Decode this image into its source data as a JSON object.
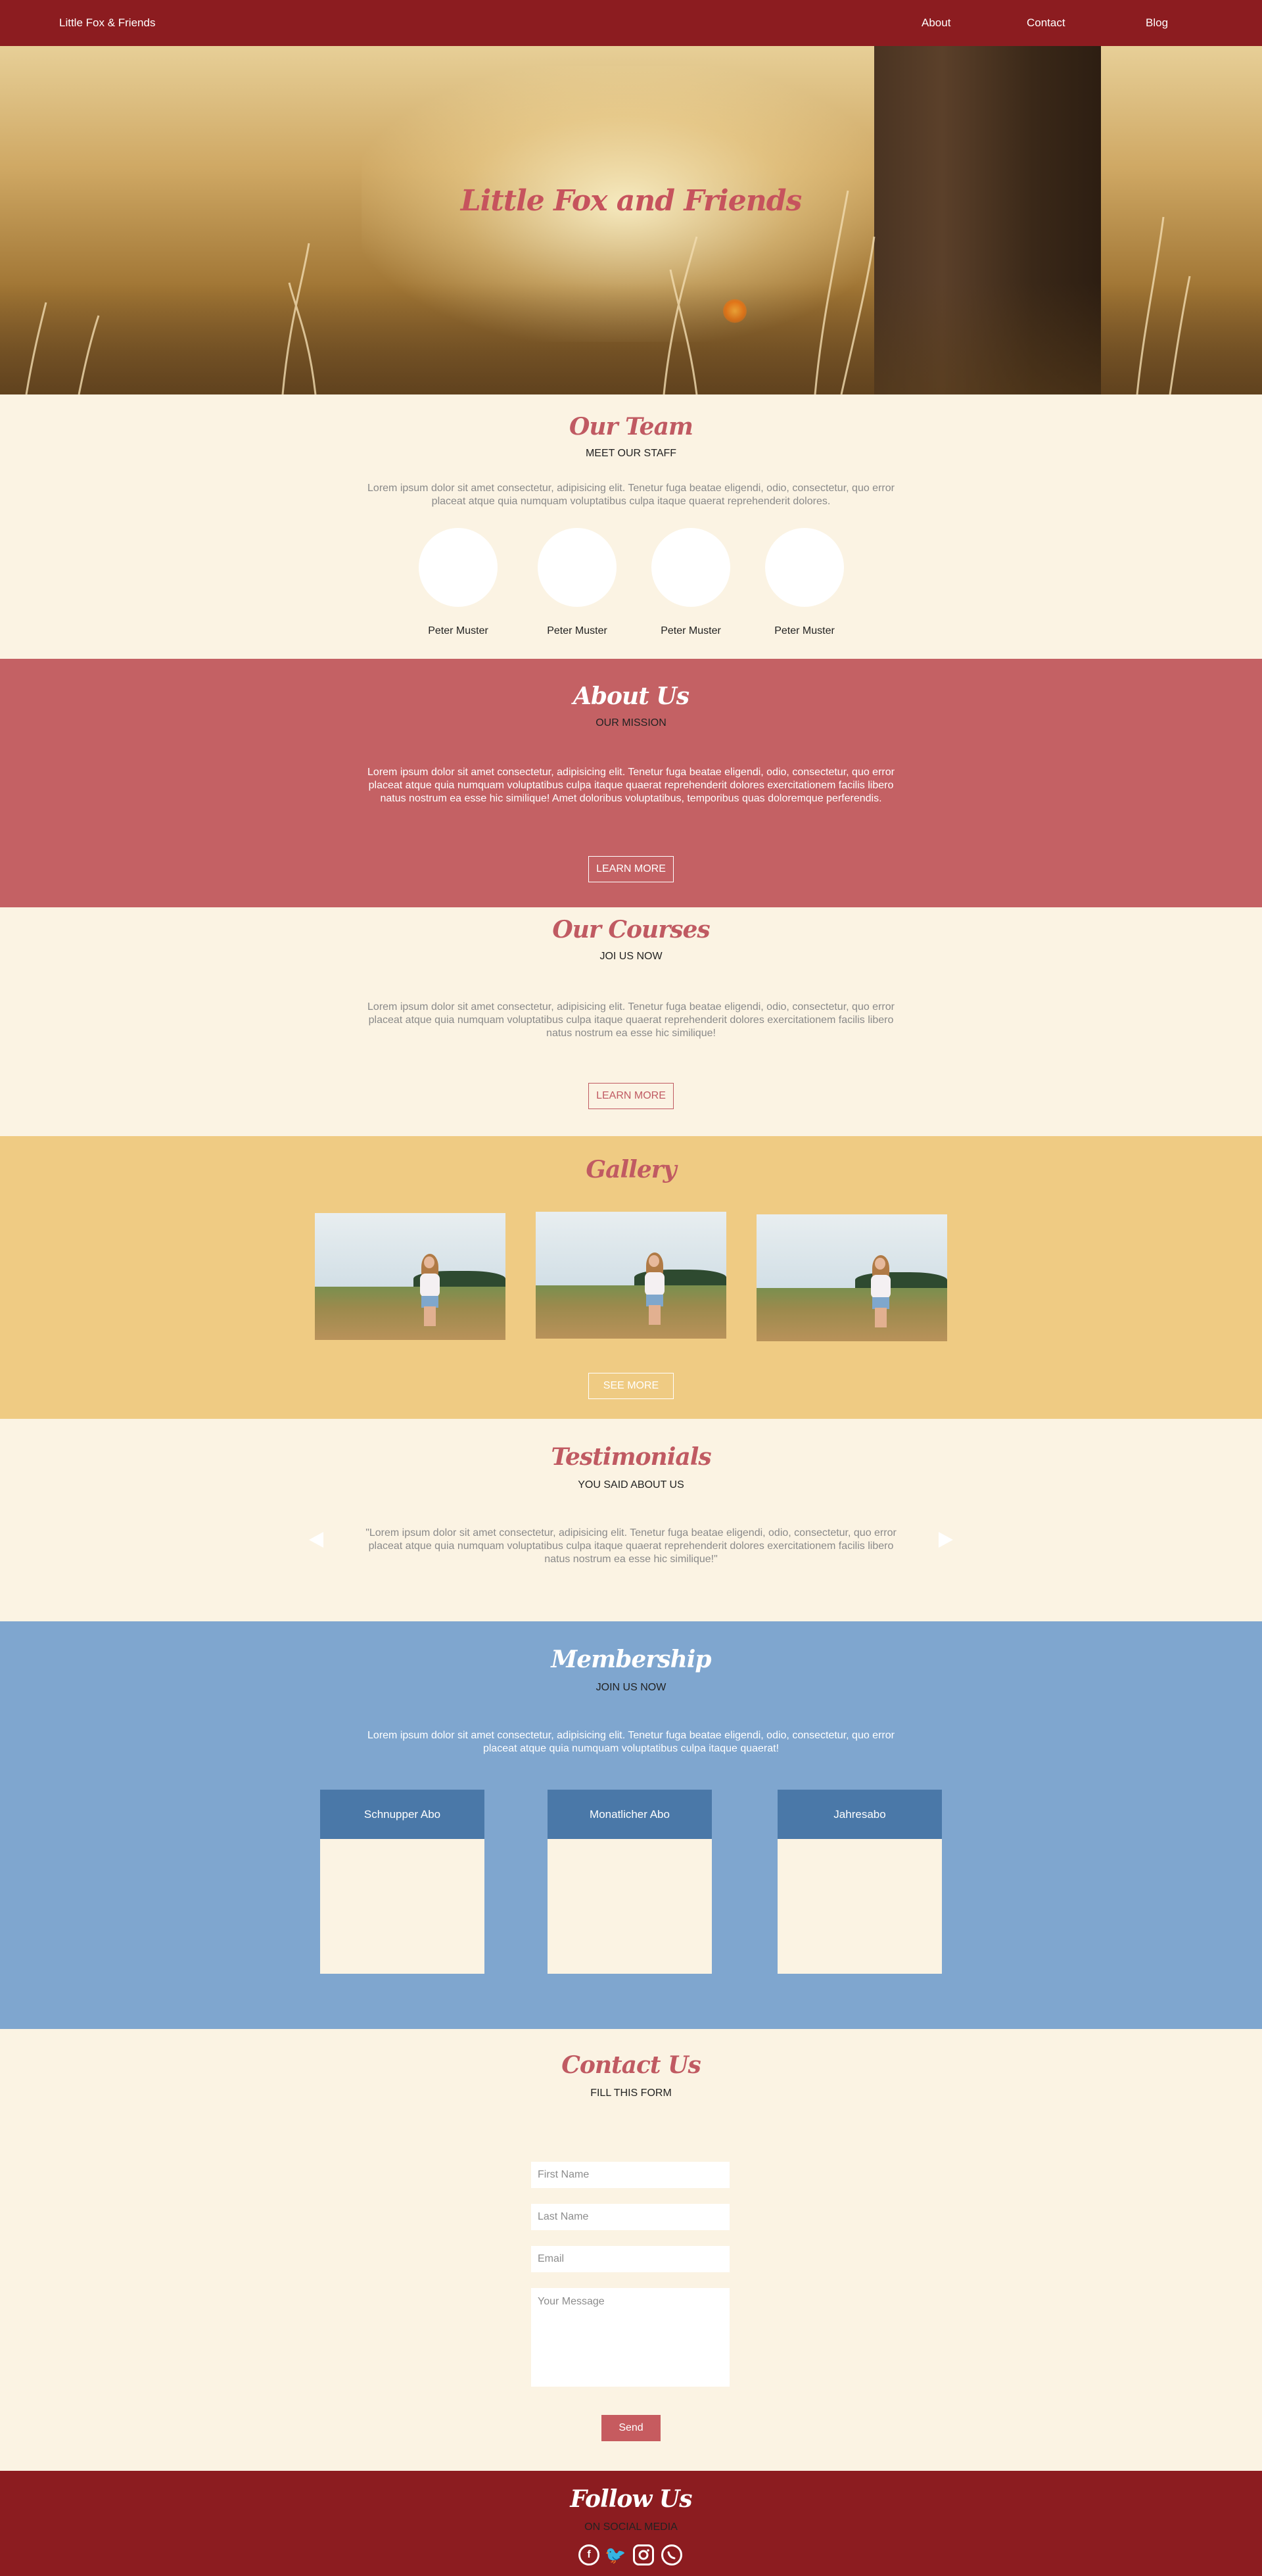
{
  "navbar": {
    "brand": "Little Fox & Friends",
    "links": [
      "About",
      "Contact",
      "Blog"
    ]
  },
  "hero": {
    "title": "Little Fox and Friends"
  },
  "team": {
    "title": "Our Team",
    "subtitle": "MEET OUR STAFF",
    "text": "Lorem ipsum dolor sit amet consectetur, adipisicing elit. Tenetur fuga beatae eligendi, odio, consectetur, quo error placeat atque quia numquam voluptatibus culpa itaque quaerat reprehenderit dolores.",
    "members": [
      "Peter Muster",
      "Peter Muster",
      "Peter Muster",
      "Peter Muster"
    ]
  },
  "about": {
    "title": "About Us",
    "subtitle": "OUR MISSION",
    "text": "Lorem ipsum dolor sit amet consectetur, adipisicing elit. Tenetur fuga beatae eligendi, odio, consectetur, quo error placeat atque quia numquam voluptatibus culpa itaque quaerat reprehenderit dolores exercitationem facilis libero natus nostrum ea esse hic similique! Amet doloribus voluptatibus, temporibus quas doloremque perferendis.",
    "button": "LEARN MORE"
  },
  "courses": {
    "title": "Our Courses",
    "subtitle": "JOI US NOW",
    "text": "Lorem ipsum dolor sit amet consectetur, adipisicing elit. Tenetur fuga beatae eligendi, odio, consectetur, quo error placeat atque quia numquam voluptatibus culpa itaque quaerat reprehenderit dolores exercitationem facilis libero natus nostrum ea esse hic similique!",
    "button": "LEARN MORE"
  },
  "gallery": {
    "title": "Gallery",
    "button": "SEE MORE"
  },
  "testimonials": {
    "title": "Testimonials",
    "subtitle": "YOU SAID ABOUT US",
    "quote": "\"Lorem ipsum dolor sit amet consectetur, adipisicing elit. Tenetur fuga beatae eligendi, odio, consectetur, quo error placeat atque quia numquam voluptatibus culpa itaque quaerat reprehenderit dolores exercitationem facilis libero natus nostrum ea esse hic similique!\""
  },
  "membership": {
    "title": "Membership",
    "subtitle": "JOIN US NOW",
    "text": "Lorem ipsum dolor sit amet consectetur, adipisicing elit. Tenetur fuga beatae eligendi, odio, consectetur, quo error placeat atque quia numquam voluptatibus culpa itaque quaerat!",
    "plans": [
      "Schnupper Abo",
      "Monatlicher Abo",
      "Jahresabo"
    ]
  },
  "contact": {
    "title": "Contact Us",
    "subtitle": "FILL THIS FORM",
    "first_name_placeholder": "First Name",
    "last_name_placeholder": "Last Name",
    "email_placeholder": "Email",
    "message_placeholder": "Your Message",
    "send": "Send"
  },
  "footer": {
    "title": "Follow Us",
    "subtitle": "ON SOCIAL MEDIA",
    "icons": [
      "facebook-icon",
      "twitter-icon",
      "instagram-icon",
      "whatsapp-icon"
    ]
  },
  "colors": {
    "navbar": "#8c1c20",
    "cream": "#fbf3e3",
    "rose": "#c46164",
    "gold": "#efcb83",
    "blue": "#7fa6cf",
    "plan_header": "#4a78a8",
    "accent_text": "#c05a62"
  }
}
